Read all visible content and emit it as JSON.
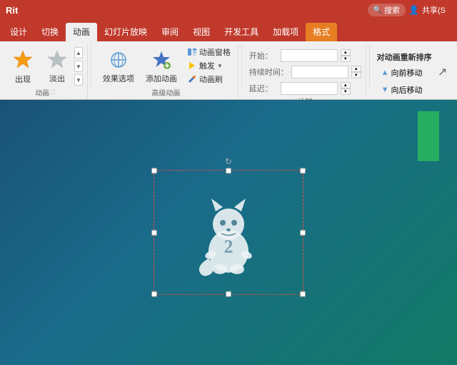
{
  "titlebar": {
    "text": "Rit",
    "bg": "#c0392b"
  },
  "tabs": [
    {
      "label": "设计",
      "active": false
    },
    {
      "label": "切换",
      "active": false
    },
    {
      "label": "动画",
      "active": true
    },
    {
      "label": "幻灯片放映",
      "active": false
    },
    {
      "label": "审阅",
      "active": false
    },
    {
      "label": "视图",
      "active": false
    },
    {
      "label": "开发工具",
      "active": false
    },
    {
      "label": "加载项",
      "active": false
    },
    {
      "label": "格式",
      "active": false,
      "highlight": true
    }
  ],
  "ribbon": {
    "groups": [
      {
        "label": "动画",
        "buttons": [
          {
            "id": "appear",
            "label": "出现",
            "type": "large"
          },
          {
            "id": "fade",
            "label": "淡出",
            "type": "large"
          }
        ]
      },
      {
        "label": "高级动画",
        "buttons": [
          {
            "id": "effects",
            "label": "效果选项",
            "type": "large"
          },
          {
            "id": "add-anim",
            "label": "添加动画",
            "type": "large"
          },
          {
            "id": "anim-window",
            "label": "动画窗格",
            "type": "small"
          },
          {
            "id": "trigger",
            "label": "触发",
            "type": "small"
          },
          {
            "id": "anim-painter",
            "label": "动画刷",
            "type": "small"
          }
        ]
      },
      {
        "label": "计时",
        "fields": [
          {
            "label": "开始：",
            "value": ""
          },
          {
            "label": "持续时间：",
            "value": ""
          },
          {
            "label": "延迟：",
            "value": ""
          }
        ]
      }
    ],
    "right": {
      "reorder_label": "对动画重新排序",
      "move_forward": "向前移动",
      "move_back": "向后移动"
    }
  },
  "search": {
    "placeholder": "搜索",
    "icon": "🔍"
  },
  "user": {
    "label": "共享(S",
    "icon": "👤"
  },
  "canvas": {
    "bg_from": "#1a5276",
    "bg_to": "#117a65"
  }
}
